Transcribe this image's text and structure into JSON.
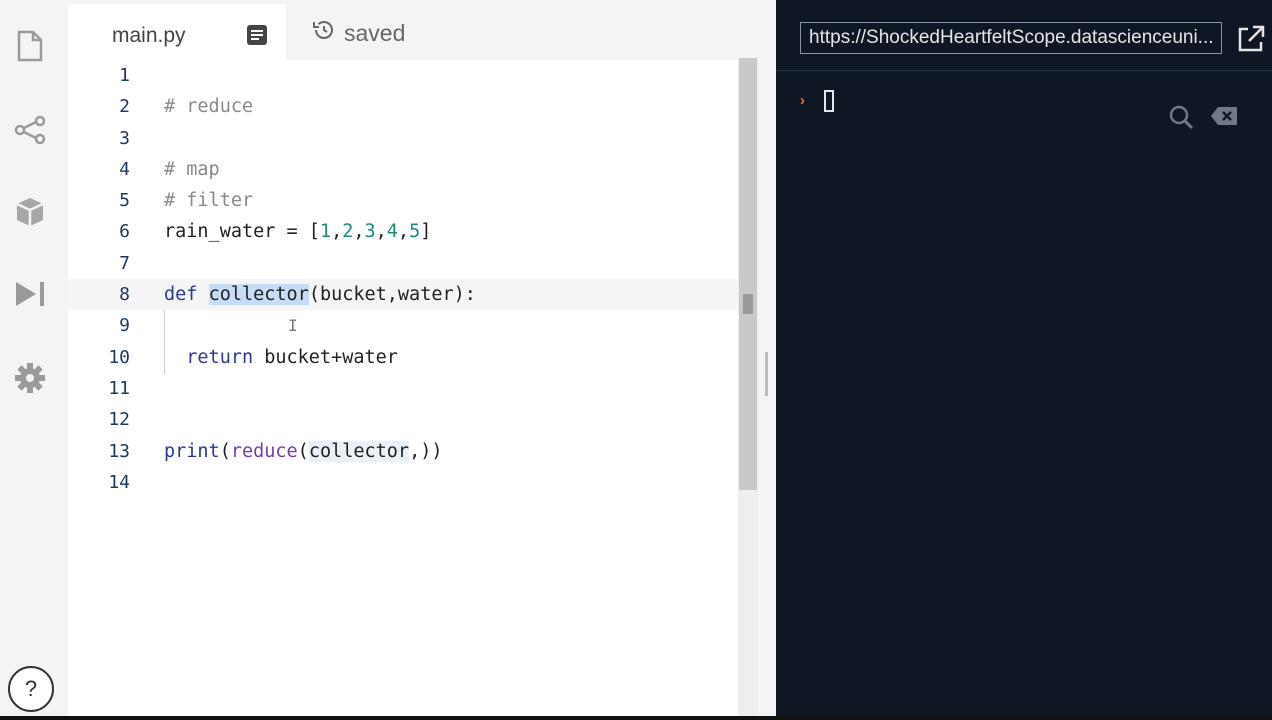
{
  "sidebar": {
    "icons": [
      "file-icon",
      "share-icon",
      "package-icon",
      "run-icon",
      "gear-icon"
    ],
    "help_label": "?"
  },
  "editor": {
    "tab_name": "main.py",
    "status": "saved",
    "line_numbers": [
      "1",
      "2",
      "3",
      "4",
      "5",
      "6",
      "7",
      "8",
      "9",
      "10",
      "11",
      "12",
      "13",
      "14"
    ],
    "code": {
      "l2": "# reduce",
      "l4": "# map",
      "l5": "# filter",
      "l6_name": "rain_water = [",
      "l6_n1": "1",
      "l6_n2": "2",
      "l6_n3": "3",
      "l6_n4": "4",
      "l6_n5": "5",
      "l8_kw": "def",
      "l8_name": "collector",
      "l8_rest": "(bucket,water):",
      "l10_kw": "return",
      "l10_rest": " bucket+water",
      "l13_print": "print",
      "l13_reduce": "reduce",
      "l13_arg": "collector",
      "l13_rest": ",))"
    }
  },
  "console": {
    "url": "https://ShockedHeartfeltScope.datascienceuni...",
    "prompt_symbol": "›"
  },
  "colors": {
    "console_bg": "#0f1624",
    "accent": "#3aa17e",
    "prompt": "#e8703a"
  }
}
